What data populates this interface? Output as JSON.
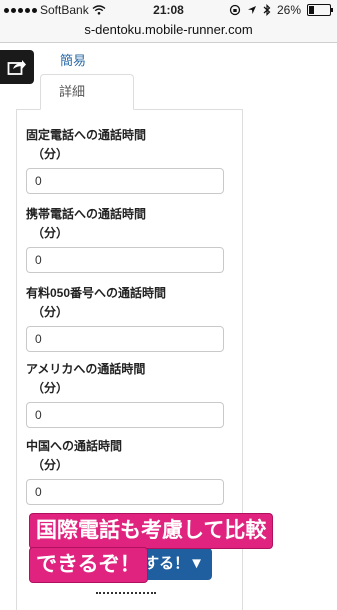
{
  "statusbar": {
    "carrier": "SoftBank",
    "time": "21:08",
    "battery": "26%"
  },
  "url": "s-dentoku.mobile-runner.com",
  "tabs": {
    "simple": "簡易",
    "detail": "詳細"
  },
  "fields": [
    {
      "label": "固定電話への通話時間",
      "unit": "（分）",
      "value": "0"
    },
    {
      "label": "携帯電話への通話時間",
      "unit": "（分）",
      "value": "0"
    },
    {
      "label": "有料050番号への通話時間",
      "unit": "（分）",
      "value": "0"
    },
    {
      "label": "アメリカへの通話時間",
      "unit": "（分）",
      "value": "0"
    },
    {
      "label": "中国への通話時間",
      "unit": "（分）",
      "value": "0"
    }
  ],
  "submit_label": "する！▼",
  "caption": {
    "line1": "国際電話も考慮して比較",
    "line2": "できるぞ！"
  }
}
